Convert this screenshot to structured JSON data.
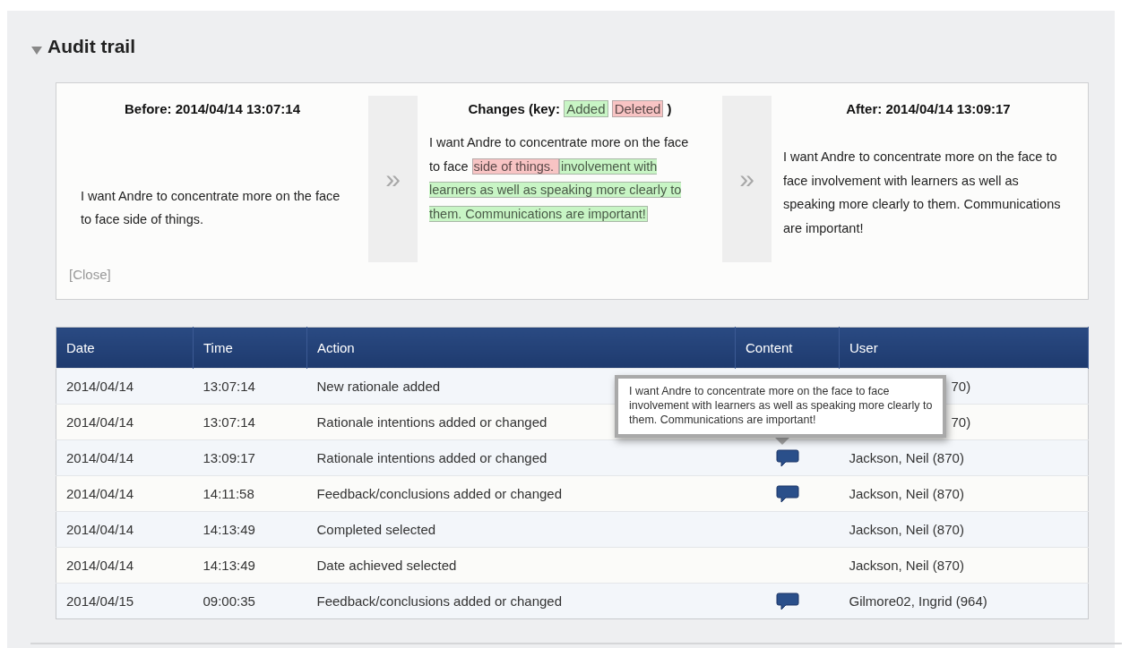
{
  "section": {
    "title": "Audit trail",
    "expanded": true
  },
  "diff": {
    "before": {
      "heading": "Before: 2014/04/14 13:07:14",
      "text": "I want Andre to concentrate more on the face to face side of things."
    },
    "changes": {
      "heading_prefix": "Changes (key:",
      "key": [
        {
          "kind": "added",
          "label": "Added"
        },
        {
          "kind": "deleted",
          "label": "Deleted"
        }
      ],
      "heading_suffix": ")",
      "segments": [
        {
          "kind": "plain",
          "text": "I want Andre to concentrate more on the face to face "
        },
        {
          "kind": "deleted",
          "text": "side of things. "
        },
        {
          "kind": "added",
          "text": "involvement with learners as well as speaking more clearly to them. Communications are important!"
        }
      ]
    },
    "after": {
      "heading": "After: 2014/04/14 13:09:17",
      "text": "I want Andre to concentrate more on the face to face involvement with learners as well as speaking more clearly to them. Communications are important!"
    },
    "arrow": "»",
    "close": "[Close]"
  },
  "table": {
    "columns": [
      "Date",
      "Time",
      "Action",
      "Content",
      "User"
    ],
    "rows": [
      {
        "date": "2014/04/14",
        "time": "13:07:14",
        "action": "New rationale added",
        "has_content": false,
        "user": "70)",
        "user_covered": true
      },
      {
        "date": "2014/04/14",
        "time": "13:07:14",
        "action": "Rationale intentions added or changed",
        "has_content": false,
        "user": "70)",
        "user_covered": true
      },
      {
        "date": "2014/04/14",
        "time": "13:09:17",
        "action": "Rationale intentions added or changed",
        "has_content": true,
        "user": "Jackson, Neil (870)",
        "user_covered": false
      },
      {
        "date": "2014/04/14",
        "time": "14:11:58",
        "action": "Feedback/conclusions added or changed",
        "has_content": true,
        "user": "Jackson, Neil (870)",
        "user_covered": false
      },
      {
        "date": "2014/04/14",
        "time": "14:13:49",
        "action": "Completed selected",
        "has_content": false,
        "user": "Jackson, Neil (870)",
        "user_covered": false
      },
      {
        "date": "2014/04/14",
        "time": "14:13:49",
        "action": "Date achieved selected",
        "has_content": false,
        "user": "Jackson, Neil (870)",
        "user_covered": false
      },
      {
        "date": "2014/04/15",
        "time": "09:00:35",
        "action": "Feedback/conclusions added or changed",
        "has_content": true,
        "user": "Gilmore02, Ingrid (964)",
        "user_covered": false
      }
    ]
  },
  "tooltip": {
    "text": "I want Andre to concentrate more on the face to face involvement with learners as well as speaking more clearly to them. Communications are important!"
  }
}
